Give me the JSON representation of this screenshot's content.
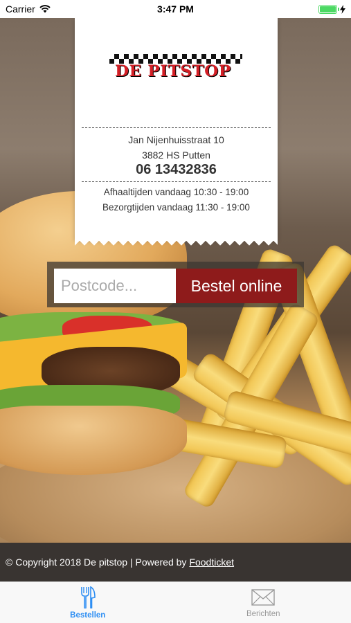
{
  "status_bar": {
    "carrier": "Carrier",
    "time": "3:47 PM"
  },
  "logo": {
    "text": "DE PITSTOP"
  },
  "address": {
    "street": "Jan Nijenhuisstraat 10",
    "city": "3882 HS Putten",
    "phone": "06 13432836"
  },
  "hours": {
    "pickup": "Afhaaltijden vandaag 10:30 - 19:00",
    "delivery": "Bezorgtijden vandaag 11:30 - 19:00"
  },
  "order": {
    "placeholder": "Postcode...",
    "button_label": "Bestel online"
  },
  "footer": {
    "copyright": "© Copyright 2018 De pitstop | Powered by",
    "link": "Foodticket"
  },
  "tabs": [
    {
      "label": "Bestellen",
      "icon": "fork-knife-icon",
      "active": true
    },
    {
      "label": "Berichten",
      "icon": "envelope-icon",
      "active": false
    }
  ],
  "colors": {
    "accent": "#2d8ef3",
    "order_button": "#8e1b1b",
    "logo_red": "#d41f26",
    "battery": "#4cd964"
  }
}
